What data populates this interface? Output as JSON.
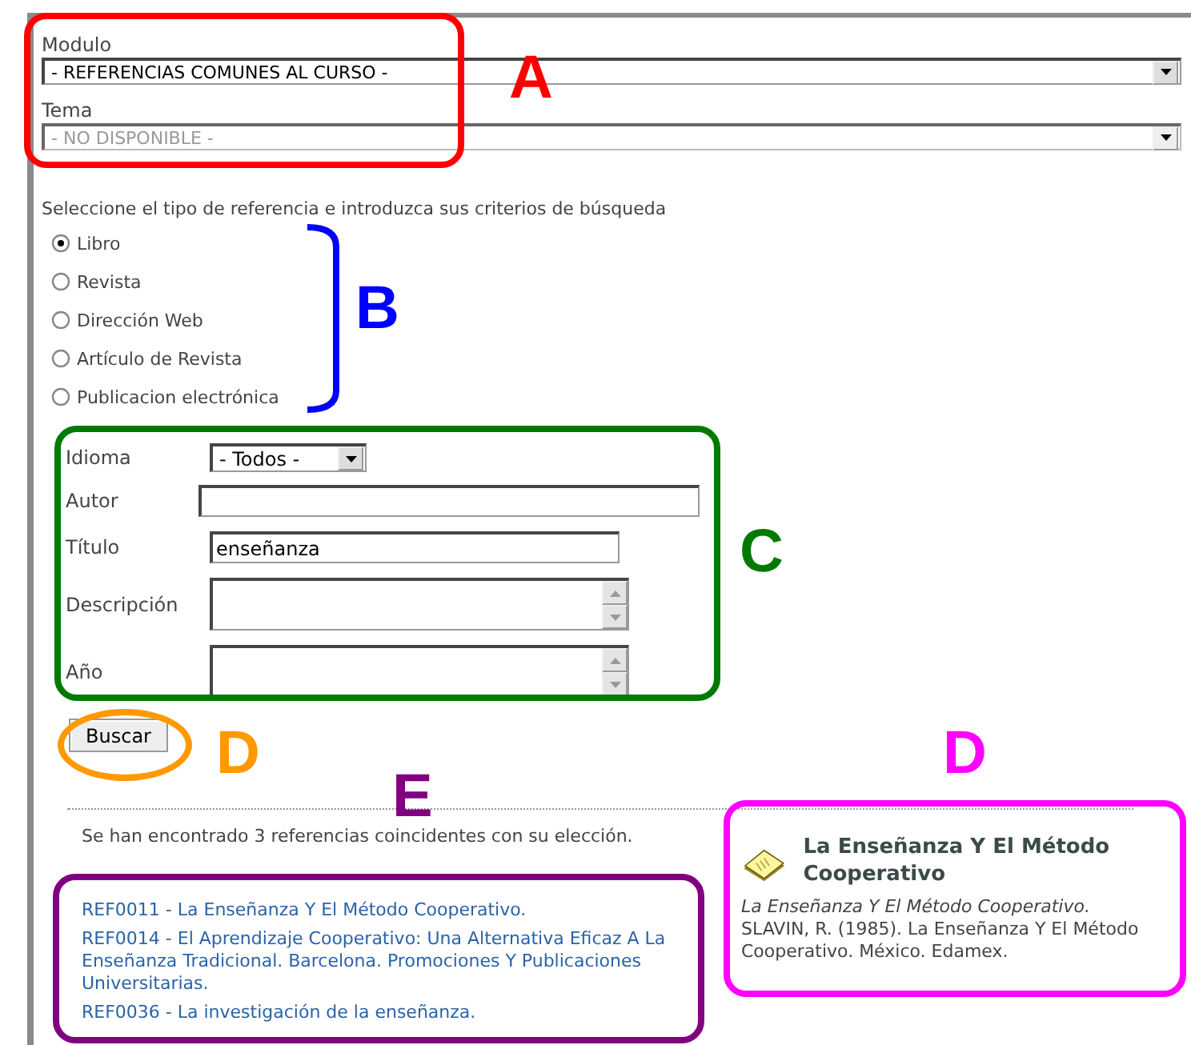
{
  "modulo": {
    "label": "Modulo",
    "value": "- REFERENCIAS COMUNES AL CURSO -",
    "disabled": false
  },
  "tema": {
    "label": "Tema",
    "value": "- NO DISPONIBLE -",
    "disabled": true
  },
  "instruction": "Seleccione el tipo de referencia e introduzca sus criterios de búsqueda",
  "reference_types": [
    {
      "label": "Libro",
      "selected": true
    },
    {
      "label": "Revista",
      "selected": false
    },
    {
      "label": "Dirección Web",
      "selected": false
    },
    {
      "label": "Artículo de Revista",
      "selected": false
    },
    {
      "label": "Publicacion electrónica",
      "selected": false
    }
  ],
  "fields": [
    {
      "kind": "select",
      "label": "Idioma",
      "value": "- Todos -"
    },
    {
      "kind": "text",
      "label": "Autor"
    },
    {
      "kind": "text",
      "label": "Título",
      "value": "enseñanza"
    },
    {
      "kind": "textarea",
      "label": "Descripción"
    },
    {
      "kind": "textarea",
      "label": "Año"
    }
  ],
  "search_button": "Buscar",
  "results_summary": "Se han encontrado 3 referencias coincidentes con su elección.",
  "results": [
    "REF0011 - La Enseñanza Y El Método Cooperativo.",
    "REF0014 - El Aprendizaje Cooperativo: Una Alternativa Eficaz A La Enseñanza Tradicional. Barcelona. Promociones Y Publicaciones Universitarias.",
    "REF0036 - La investigación de la enseñanza."
  ],
  "detail": {
    "title": "La Enseñanza Y El Método Cooperativo",
    "subtitle": "La Enseñanza Y El Método Cooperativo.",
    "citation": "SLAVIN, R. (1985). La Enseñanza Y El Método Cooperativo. México. Edamex."
  },
  "annotations": [
    {
      "kind": "box",
      "color": "#ff0000"
    },
    {
      "kind": "letter",
      "text": "A",
      "color": "#ff0000"
    },
    {
      "kind": "bracket",
      "color": "#0000ff"
    },
    {
      "kind": "letter",
      "text": "B",
      "color": "#0000ff"
    },
    {
      "kind": "box",
      "color": "#007a00"
    },
    {
      "kind": "letter",
      "text": "C",
      "color": "#007a00"
    },
    {
      "kind": "ellipse",
      "color": "#ff9900"
    },
    {
      "kind": "letter",
      "text": "D",
      "color": "#ff9900"
    },
    {
      "kind": "letter",
      "text": "D",
      "color": "#ff00ff"
    },
    {
      "kind": "box",
      "color": "#ff00ff"
    },
    {
      "kind": "letter",
      "text": "E",
      "color": "#800080"
    },
    {
      "kind": "box",
      "color": "#800080"
    }
  ]
}
